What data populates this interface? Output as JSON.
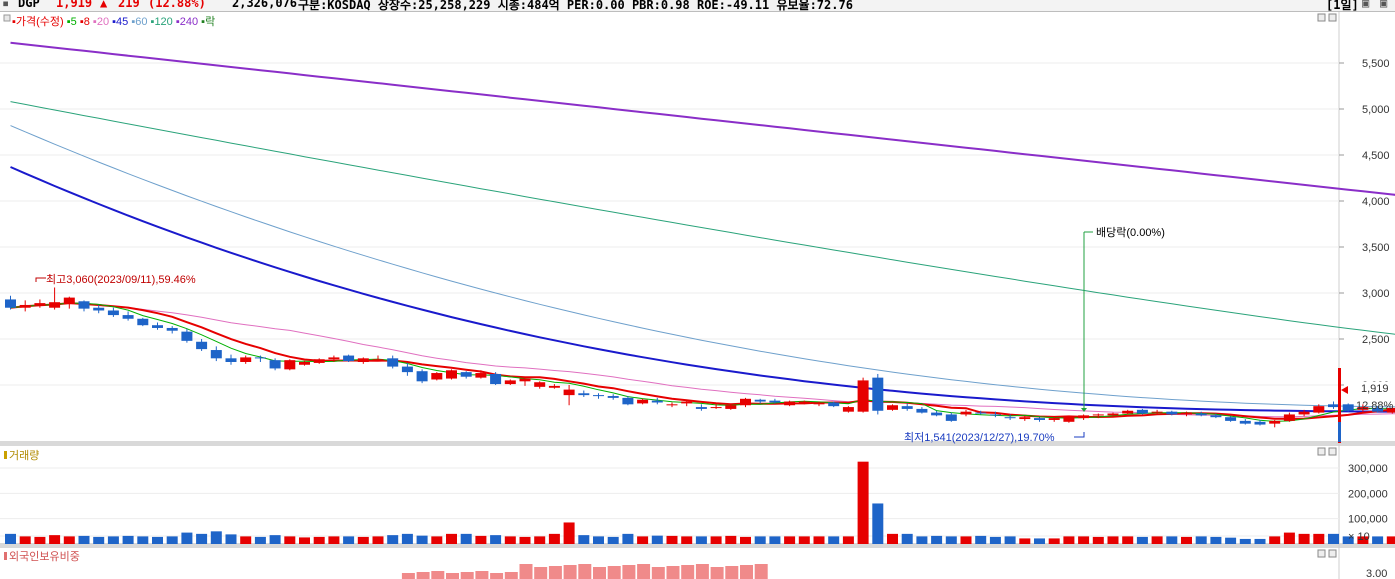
{
  "header": {
    "code": "DGP",
    "price": "1,919",
    "change_arrow": "▲",
    "change": "219",
    "change_pct": "(12.88%)",
    "volume": "2,326,076",
    "info": "구분:KOSDAQ 상장수:25,258,229 시총:484억 PER:0.00 PBR:0.98 ROE:-49.11 유보율:72.76",
    "period": "[1일]",
    "colors": {
      "up": "#e60000",
      "down": "#1e64c8"
    }
  },
  "price_panel": {
    "legend": [
      {
        "label": "가격(수정)",
        "color": "#e60000"
      },
      {
        "label": "5",
        "color": "#00b000"
      },
      {
        "label": "8",
        "color": "#e60000"
      },
      {
        "label": "20",
        "color": "#e070c0"
      },
      {
        "label": "45",
        "color": "#1a1acc"
      },
      {
        "label": "60",
        "color": "#6ea0cc"
      },
      {
        "label": "120",
        "color": "#2aa37a"
      },
      {
        "label": "240",
        "color": "#8a2ec8"
      },
      {
        "label": "락",
        "color": "#208020"
      }
    ],
    "high_annotation": "최고3,060(2023/09/11),59.46%",
    "low_annotation": "최저1,541(2023/12/27),19.70%",
    "dividend_annotation": "배당락(0.00%)",
    "current_price_label": "1,919",
    "current_pct_label": "12.88%"
  },
  "volume_panel": {
    "title": "거래량"
  },
  "foreign_panel": {
    "title": "외국인보유비중",
    "axis_top": "3.00"
  },
  "chart_data": {
    "type": "candlestick",
    "y_ticks": [
      5500,
      5000,
      4500,
      4000,
      3500,
      3000,
      2500,
      2000
    ],
    "y_tick_labels": [
      "5,500",
      "5,000",
      "4,500",
      "4,000",
      "3,500",
      "3,000",
      "2,500",
      "2,000"
    ],
    "ylim": [
      1250,
      5900
    ],
    "volume_ticks": [
      300000,
      200000,
      100000,
      10
    ],
    "volume_tick_labels": [
      "300,000",
      "200,000",
      "100,000",
      "10"
    ],
    "volume_ylim": [
      0,
      360000
    ],
    "high": {
      "value": 3060,
      "date": "2023/09/11",
      "pct": 59.46
    },
    "low": {
      "value": 1541,
      "date": "2023/12/27",
      "pct": 19.7
    },
    "last": {
      "price": 1919,
      "change": 219,
      "pct": 12.88
    },
    "candles": [
      [
        2930,
        2970,
        2820,
        2840,
        40000
      ],
      [
        2840,
        2920,
        2800,
        2870,
        30000
      ],
      [
        2860,
        2930,
        2840,
        2890,
        28000
      ],
      [
        2840,
        3060,
        2820,
        2900,
        35000
      ],
      [
        2880,
        2960,
        2830,
        2950,
        30000
      ],
      [
        2910,
        2920,
        2800,
        2830,
        32000
      ],
      [
        2840,
        2870,
        2780,
        2810,
        28000
      ],
      [
        2810,
        2840,
        2740,
        2760,
        30000
      ],
      [
        2760,
        2800,
        2700,
        2720,
        32000
      ],
      [
        2720,
        2730,
        2640,
        2650,
        30000
      ],
      [
        2650,
        2680,
        2600,
        2620,
        28000
      ],
      [
        2620,
        2640,
        2560,
        2590,
        30000
      ],
      [
        2580,
        2610,
        2460,
        2480,
        45000
      ],
      [
        2470,
        2500,
        2370,
        2390,
        40000
      ],
      [
        2380,
        2420,
        2260,
        2290,
        50000
      ],
      [
        2290,
        2330,
        2220,
        2250,
        38000
      ],
      [
        2250,
        2320,
        2230,
        2300,
        30000
      ],
      [
        2300,
        2320,
        2250,
        2290,
        28000
      ],
      [
        2270,
        2290,
        2160,
        2180,
        35000
      ],
      [
        2170,
        2280,
        2160,
        2270,
        30000
      ],
      [
        2220,
        2260,
        2210,
        2250,
        26000
      ],
      [
        2240,
        2290,
        2230,
        2280,
        28000
      ],
      [
        2280,
        2320,
        2250,
        2300,
        30000
      ],
      [
        2320,
        2330,
        2250,
        2260,
        30000
      ],
      [
        2250,
        2300,
        2230,
        2290,
        28000
      ],
      [
        2280,
        2320,
        2260,
        2280,
        30000
      ],
      [
        2290,
        2320,
        2180,
        2200,
        35000
      ],
      [
        2200,
        2240,
        2100,
        2140,
        40000
      ],
      [
        2150,
        2170,
        2020,
        2040,
        33000
      ],
      [
        2060,
        2140,
        2050,
        2130,
        30000
      ],
      [
        2070,
        2170,
        2060,
        2160,
        40000
      ],
      [
        2140,
        2150,
        2070,
        2090,
        40000
      ],
      [
        2080,
        2160,
        2070,
        2130,
        32000
      ],
      [
        2120,
        2140,
        2000,
        2010,
        35000
      ],
      [
        2010,
        2060,
        2000,
        2050,
        30000
      ],
      [
        2040,
        2080,
        1990,
        2070,
        28000
      ],
      [
        1980,
        2040,
        1960,
        2030,
        30000
      ],
      [
        1970,
        2010,
        1960,
        1990,
        40000
      ],
      [
        1890,
        2000,
        1780,
        1950,
        85000
      ],
      [
        1910,
        1940,
        1870,
        1890,
        35000
      ],
      [
        1890,
        1910,
        1850,
        1880,
        30000
      ],
      [
        1880,
        1900,
        1840,
        1860,
        28000
      ],
      [
        1860,
        1880,
        1780,
        1790,
        40000
      ],
      [
        1800,
        1850,
        1790,
        1840,
        30000
      ],
      [
        1830,
        1860,
        1790,
        1810,
        33000
      ],
      [
        1780,
        1810,
        1760,
        1790,
        32000
      ],
      [
        1800,
        1840,
        1770,
        1820,
        30000
      ],
      [
        1760,
        1790,
        1720,
        1740,
        30000
      ],
      [
        1760,
        1800,
        1740,
        1760,
        30000
      ],
      [
        1740,
        1790,
        1730,
        1780,
        32000
      ],
      [
        1780,
        1860,
        1760,
        1850,
        28000
      ],
      [
        1840,
        1850,
        1800,
        1820,
        30000
      ],
      [
        1830,
        1850,
        1800,
        1810,
        30000
      ],
      [
        1780,
        1830,
        1770,
        1820,
        30000
      ],
      [
        1800,
        1830,
        1790,
        1820,
        30000
      ],
      [
        1790,
        1820,
        1770,
        1810,
        30000
      ],
      [
        1810,
        1820,
        1760,
        1770,
        30000
      ],
      [
        1710,
        1770,
        1700,
        1760,
        30000
      ],
      [
        1710,
        2080,
        1700,
        2050,
        325000
      ],
      [
        2080,
        2120,
        1680,
        1720,
        160000
      ],
      [
        1730,
        1790,
        1720,
        1780,
        40000
      ],
      [
        1770,
        1800,
        1720,
        1740,
        40000
      ],
      [
        1740,
        1760,
        1690,
        1700,
        30000
      ],
      [
        1700,
        1720,
        1660,
        1670,
        32000
      ],
      [
        1680,
        1700,
        1600,
        1610,
        30000
      ],
      [
        1680,
        1730,
        1660,
        1710,
        30000
      ],
      [
        1700,
        1720,
        1680,
        1690,
        32000
      ],
      [
        1680,
        1710,
        1650,
        1670,
        28000
      ],
      [
        1650,
        1680,
        1620,
        1640,
        30000
      ],
      [
        1630,
        1660,
        1610,
        1650,
        22000
      ],
      [
        1640,
        1650,
        1600,
        1620,
        22000
      ],
      [
        1620,
        1650,
        1600,
        1640,
        22000
      ],
      [
        1600,
        1660,
        1590,
        1650,
        30000
      ],
      [
        1640,
        1680,
        1620,
        1670,
        30000
      ],
      [
        1670,
        1690,
        1640,
        1680,
        28000
      ],
      [
        1670,
        1700,
        1660,
        1690,
        30000
      ],
      [
        1690,
        1730,
        1680,
        1720,
        30000
      ],
      [
        1730,
        1740,
        1680,
        1690,
        28000
      ],
      [
        1700,
        1730,
        1690,
        1710,
        30000
      ],
      [
        1710,
        1720,
        1670,
        1680,
        30000
      ],
      [
        1680,
        1710,
        1660,
        1700,
        28000
      ],
      [
        1690,
        1710,
        1660,
        1670,
        30000
      ],
      [
        1670,
        1690,
        1640,
        1650,
        28000
      ],
      [
        1650,
        1660,
        1600,
        1610,
        25000
      ],
      [
        1610,
        1630,
        1570,
        1580,
        20000
      ],
      [
        1600,
        1620,
        1560,
        1570,
        20000
      ],
      [
        1580,
        1620,
        1540,
        1610,
        30000
      ],
      [
        1610,
        1700,
        1600,
        1680,
        45000
      ],
      [
        1680,
        1730,
        1660,
        1710,
        40000
      ],
      [
        1700,
        1790,
        1690,
        1770,
        40000
      ],
      [
        1790,
        1820,
        1740,
        1760,
        40000
      ],
      [
        1790,
        1800,
        1710,
        1720,
        30000
      ],
      [
        1730,
        1790,
        1710,
        1760,
        30000
      ],
      [
        1750,
        1770,
        1700,
        1710,
        30000
      ],
      [
        1700,
        1760,
        1690,
        1750,
        30000
      ],
      [
        1730,
        1760,
        1700,
        1720,
        30000
      ],
      [
        1690,
        1740,
        1680,
        1730,
        28000
      ],
      [
        1700,
        1700,
        1700,
        1700,
        5000
      ],
      [
        1700,
        2020,
        1690,
        1919,
        232000
      ]
    ]
  }
}
